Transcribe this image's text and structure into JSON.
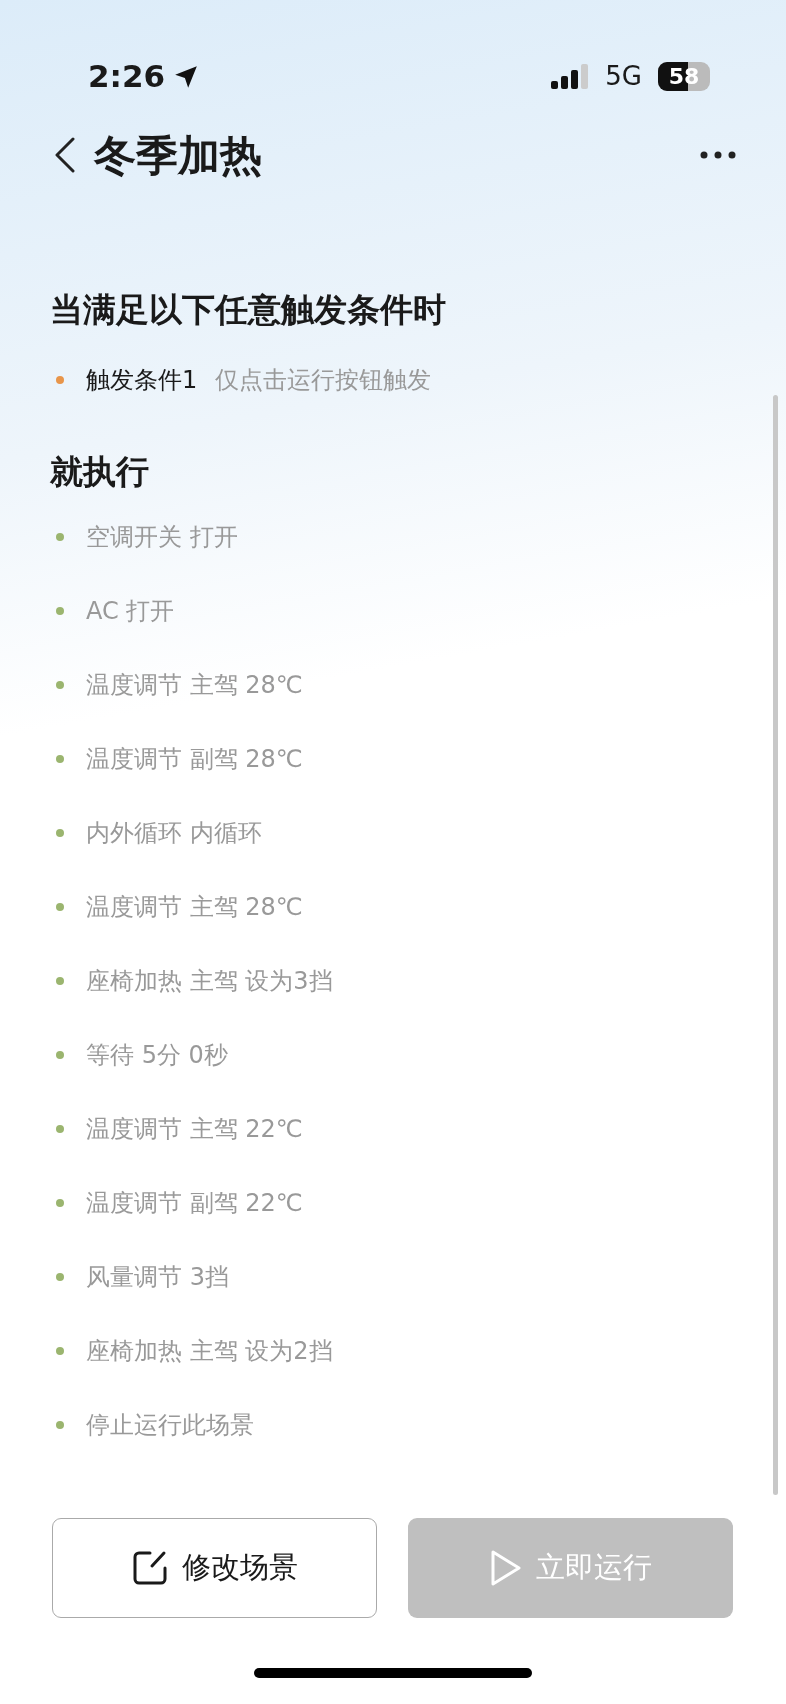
{
  "status_bar": {
    "time": "2:26",
    "network": "5G",
    "battery": "58"
  },
  "header": {
    "title": "冬季加热"
  },
  "trigger_section": {
    "title": "当满足以下任意触发条件时",
    "items": [
      {
        "label": "触发条件1",
        "detail": "仅点击运行按钮触发",
        "color": "#e8954a"
      }
    ]
  },
  "action_section": {
    "title": "就执行",
    "items": [
      {
        "label": "空调开关 打开",
        "color": "#9bb56f"
      },
      {
        "label": "AC 打开",
        "color": "#9bb56f"
      },
      {
        "label": "温度调节 主驾 28℃",
        "color": "#9bb56f"
      },
      {
        "label": "温度调节 副驾 28℃",
        "color": "#9bb56f"
      },
      {
        "label": "内外循环 内循环",
        "color": "#9bb56f"
      },
      {
        "label": "温度调节 主驾 28℃",
        "color": "#9bb56f"
      },
      {
        "label": "座椅加热 主驾 设为3挡",
        "color": "#9bb56f"
      },
      {
        "label": "等待 5分 0秒",
        "color": "#9bb56f"
      },
      {
        "label": "温度调节 主驾 22℃",
        "color": "#9bb56f"
      },
      {
        "label": "温度调节 副驾 22℃",
        "color": "#9bb56f"
      },
      {
        "label": "风量调节 3挡",
        "color": "#9bb56f"
      },
      {
        "label": "座椅加热 主驾 设为2挡",
        "color": "#9bb56f"
      },
      {
        "label": "停止运行此场景",
        "color": "#9bb56f"
      }
    ]
  },
  "buttons": [
    {
      "kind": "edit",
      "label": "修改场景",
      "disabled": false
    },
    {
      "kind": "run",
      "label": "立即运行",
      "disabled": true
    }
  ]
}
